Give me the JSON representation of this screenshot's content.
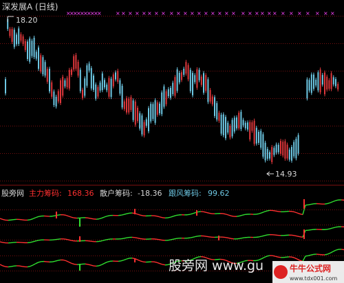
{
  "title": "深发展A (日线)",
  "price_labels": {
    "high": "18.20",
    "low": "14.93"
  },
  "indicator": {
    "name": "股旁网",
    "main_label": "主力筹码:",
    "main_value": "168.36",
    "retail_label": "散户筹码:",
    "retail_value": "-18.36",
    "follow_label": "跟风筹码:",
    "follow_value": "99.62"
  },
  "watermark": {
    "text": "股旁网 www.gu",
    "stamp": "牛牛公式网",
    "stamp_url": "www.tdx001.com"
  },
  "colors": {
    "up": "#e0383c",
    "down": "#6ec8e4",
    "grid": "#7a1010",
    "marker": "#ff44ff",
    "main": "#ff3030",
    "follow": "#6ec8e4",
    "line_up": "#30e030",
    "line_down": "#ff3030",
    "text": "#d8d8d8"
  }
}
